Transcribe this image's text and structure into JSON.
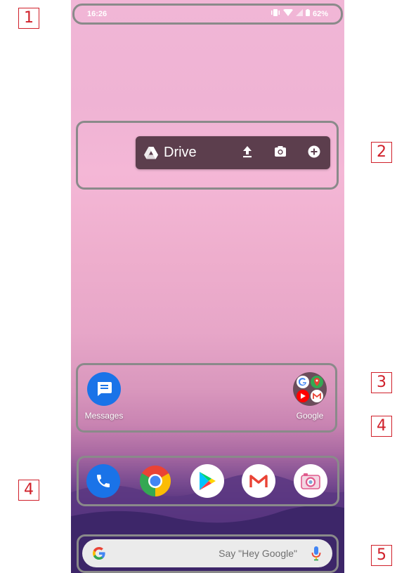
{
  "callouts": [
    "1",
    "2",
    "3",
    "4",
    "4",
    "5"
  ],
  "status_bar": {
    "time": "16:26",
    "battery": "62%"
  },
  "drive_widget": {
    "title": "Drive",
    "actions": [
      "upload-icon",
      "camera-icon",
      "add-icon"
    ]
  },
  "home_apps": [
    {
      "label": "Messages",
      "icon": "messages-icon",
      "color": "#1a73e8"
    },
    {
      "label": "Google",
      "icon": "google-folder-icon",
      "color": "#6b4d5b"
    }
  ],
  "dock": [
    {
      "app": "phone",
      "icon": "phone-icon",
      "color": "#1a73e8"
    },
    {
      "app": "chrome",
      "icon": "chrome-icon"
    },
    {
      "app": "play-store",
      "icon": "play-store-icon"
    },
    {
      "app": "gmail",
      "icon": "gmail-icon"
    },
    {
      "app": "camera",
      "icon": "camera-app-icon"
    }
  ],
  "search_bar": {
    "hint": "Say \"Hey Google\""
  },
  "colors": {
    "annotation_red": "#d0202a",
    "highlight_frame": "#8a8a8a",
    "widget_bg": "#5c3e4d",
    "search_bg": "#ebebeb"
  }
}
